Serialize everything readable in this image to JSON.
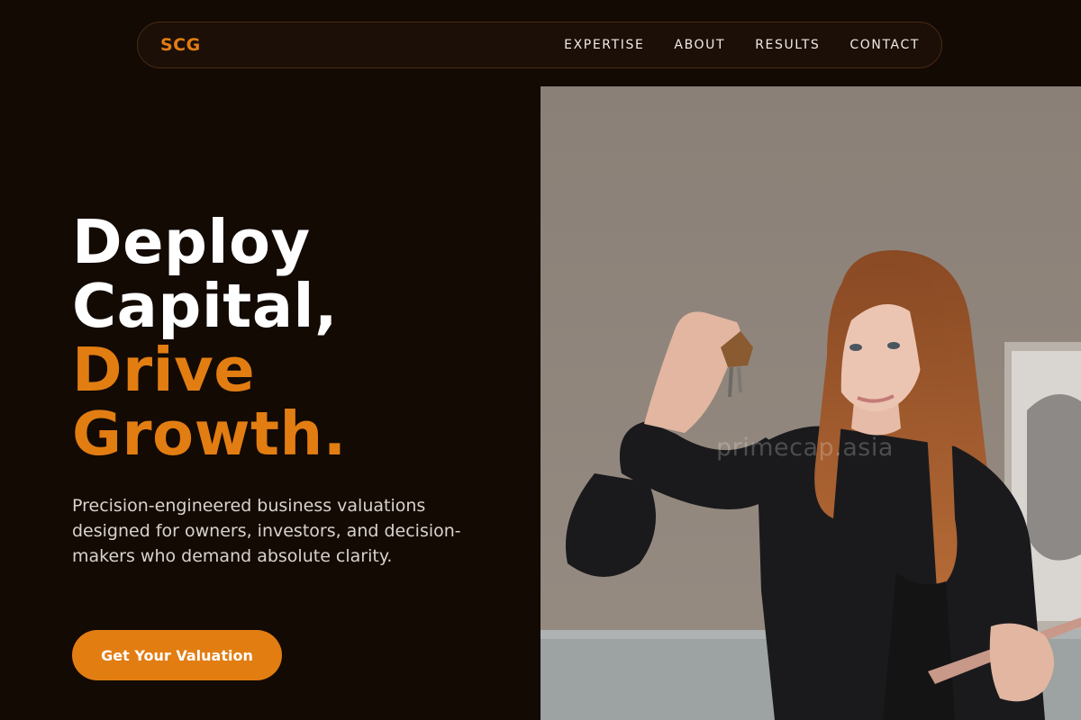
{
  "nav": {
    "logo": "SCG",
    "links": [
      "EXPERTISE",
      "ABOUT",
      "RESULTS",
      "CONTACT"
    ]
  },
  "hero": {
    "headline_lines": [
      "Deploy",
      "Capital,"
    ],
    "headline_accent_lines": [
      "Drive",
      "Growth."
    ],
    "subtext": "Precision-engineered business valuations designed for owners, investors, and decision-makers who demand absolute clarity.",
    "cta_label": "Get Your Valuation",
    "image_watermark": "primecap.asia"
  },
  "colors": {
    "background": "#130a04",
    "accent": "#e27d12",
    "nav_border": "#4a2a12",
    "text_primary": "#ffffff",
    "text_secondary": "#d9d2cc"
  },
  "icons": {
    "photo": "woman-holding-keys-photo"
  }
}
